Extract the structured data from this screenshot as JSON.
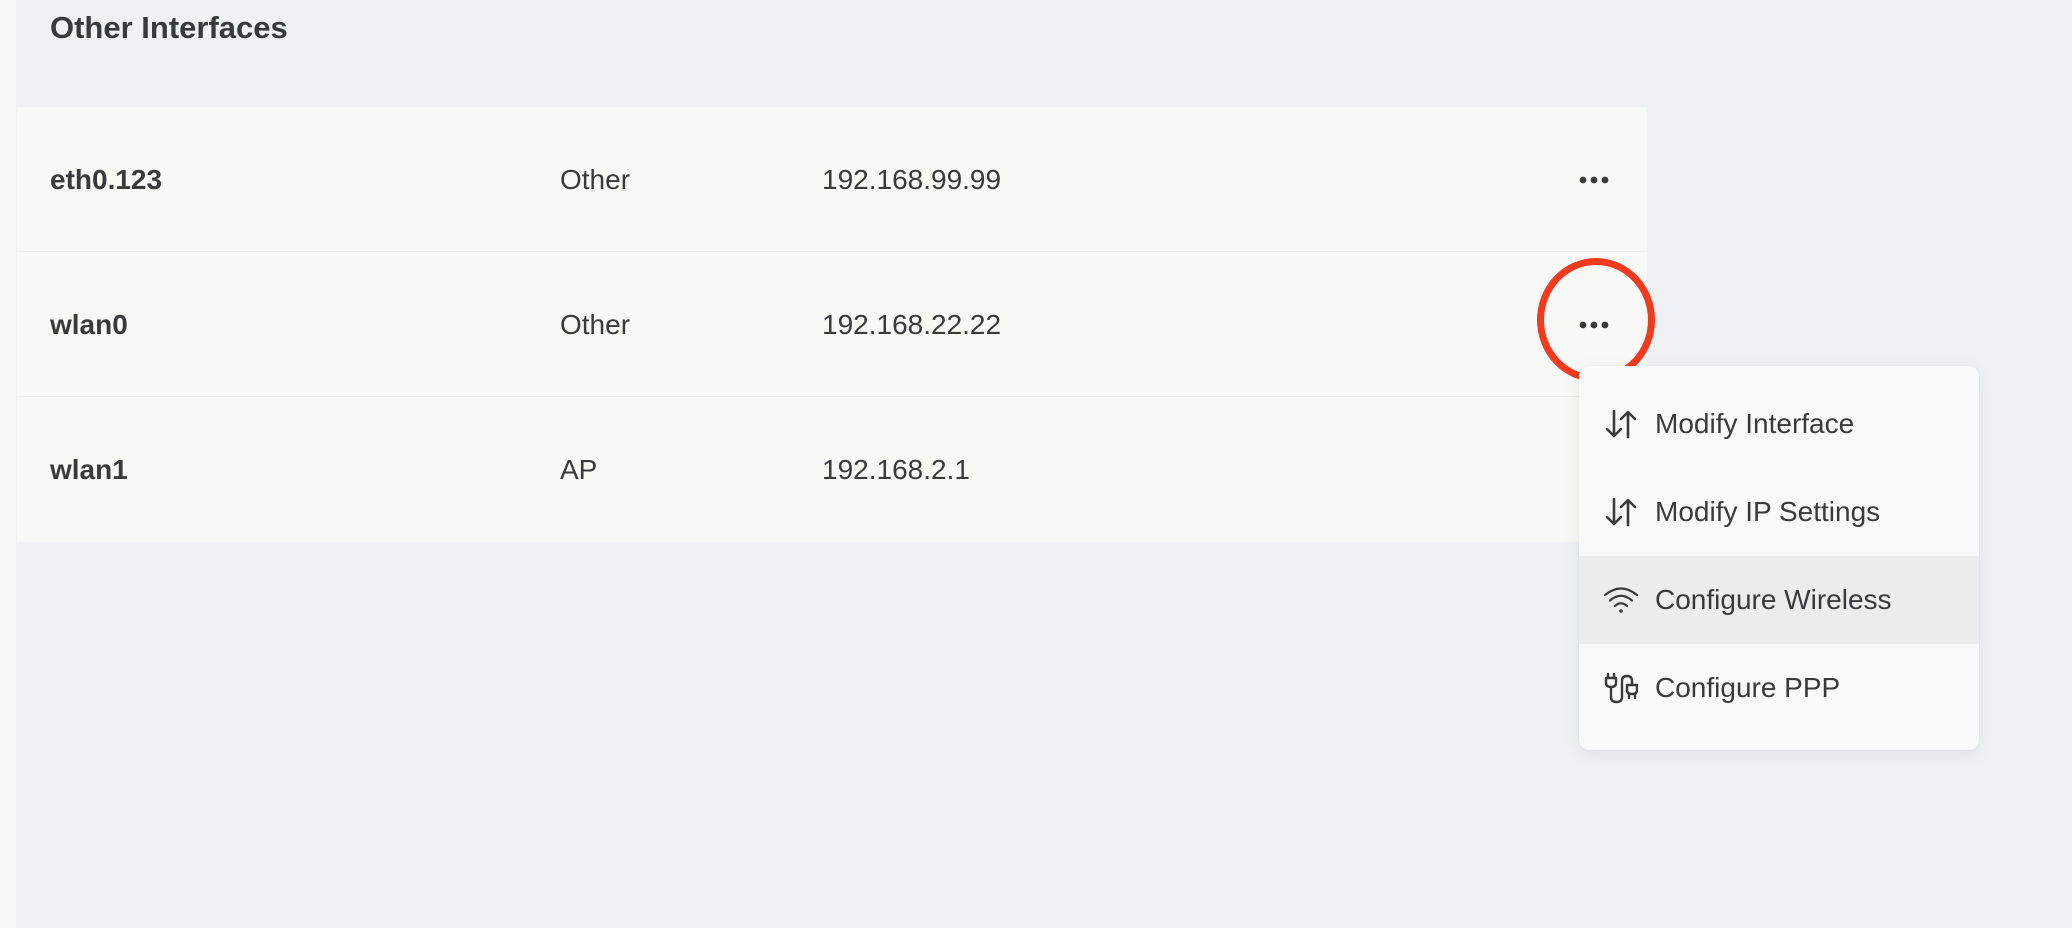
{
  "section": {
    "title": "Other Interfaces"
  },
  "interfaces": [
    {
      "name": "eth0.123",
      "type": "Other",
      "ip": "192.168.99.99"
    },
    {
      "name": "wlan0",
      "type": "Other",
      "ip": "192.168.22.22"
    },
    {
      "name": "wlan1",
      "type": "AP",
      "ip": "192.168.2.1"
    }
  ],
  "menu": {
    "items": [
      {
        "label": "Modify Interface",
        "icon": "arrows-updown-icon"
      },
      {
        "label": "Modify IP Settings",
        "icon": "arrows-updown-icon"
      },
      {
        "label": "Configure Wireless",
        "icon": "wifi-icon"
      },
      {
        "label": "Configure PPP",
        "icon": "plug-icon"
      }
    ]
  },
  "colors": {
    "highlight": "#f23a1c",
    "background": "#f0f1f5",
    "row": "#f8f8f7"
  }
}
